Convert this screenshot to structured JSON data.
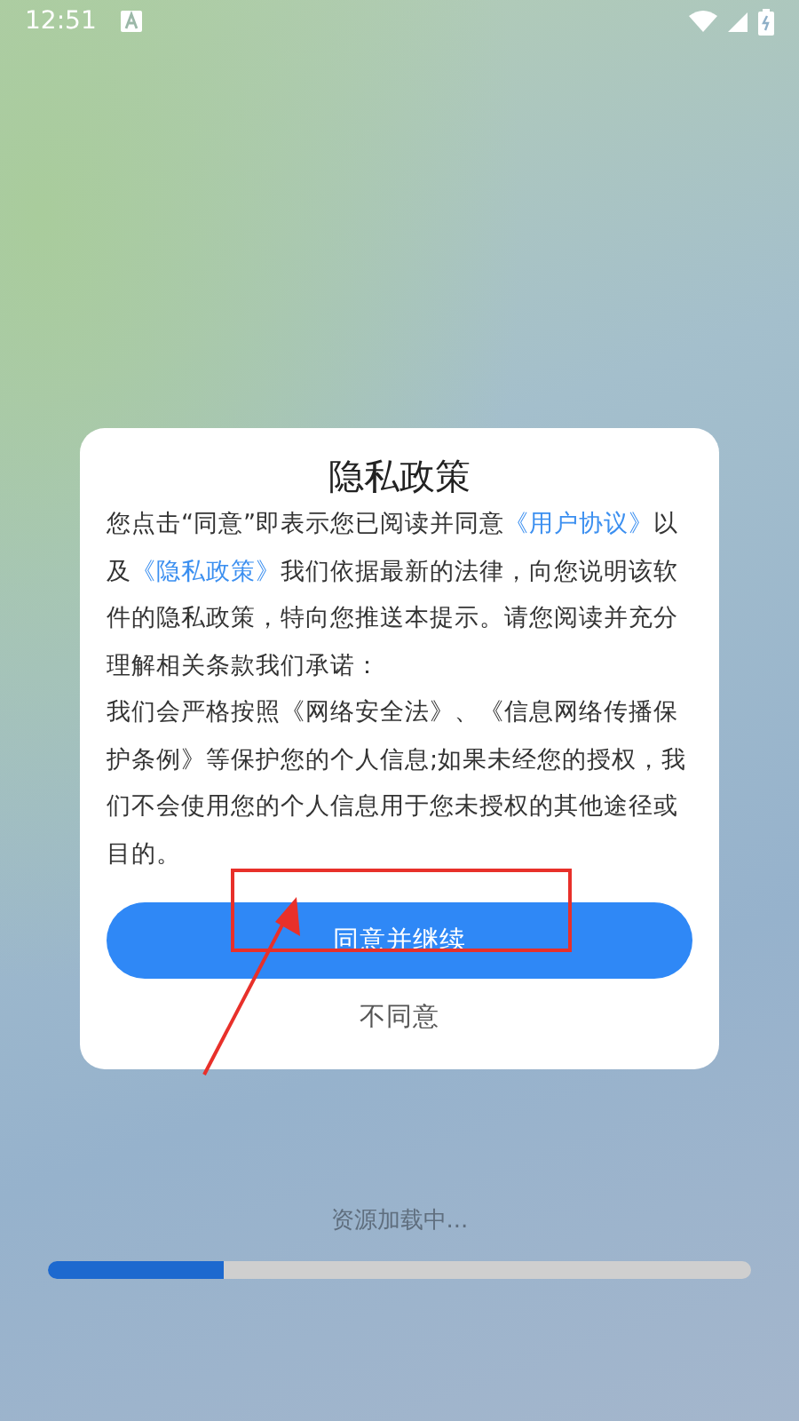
{
  "status_bar": {
    "time": "12:51"
  },
  "dialog": {
    "title": "隐私政策",
    "paragraphs": [
      {
        "segments": [
          {
            "kind": "text",
            "text": "您点击“同意”即表示您已阅读并同意"
          },
          {
            "kind": "link",
            "text": "《用户协议》"
          },
          {
            "kind": "text",
            "text": "以及"
          },
          {
            "kind": "link",
            "text": "《隐私政策》"
          },
          {
            "kind": "text",
            "text": "我们依据最新的法律，向您说明该软件的隐私政策，特向您推送本提示。请您阅读并充分理解相关条款我们承诺："
          }
        ]
      },
      {
        "segments": [
          {
            "kind": "text",
            "text": "我们会严格按照《网络安全法》、《信息网络传播保护条例》等保护您的个人信息;如果未经您的授权，我们不会使用您的个人信息用于您未授权的其他途径或目的。"
          }
        ]
      }
    ],
    "agree_button": "同意并继续",
    "decline_button": "不同意"
  },
  "loading": {
    "text": "资源加载中...",
    "level": 0.25
  },
  "annotation": {
    "highlight": true,
    "arrow": true
  }
}
